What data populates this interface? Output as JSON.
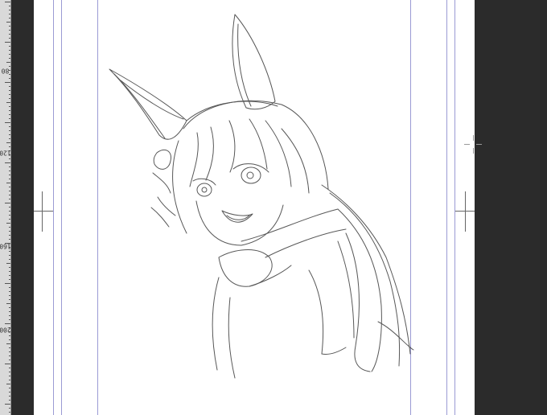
{
  "ruler": {
    "labels": [
      {
        "text": "80"
      },
      {
        "text": "120"
      },
      {
        "text": "160"
      },
      {
        "text": "200"
      }
    ]
  },
  "colors": {
    "workspace": "#2b2b2b",
    "paper": "#ffffff",
    "guide": "#9b9bd4",
    "ruler": "#d9d9d9",
    "sketch": "#3a3a3a"
  }
}
